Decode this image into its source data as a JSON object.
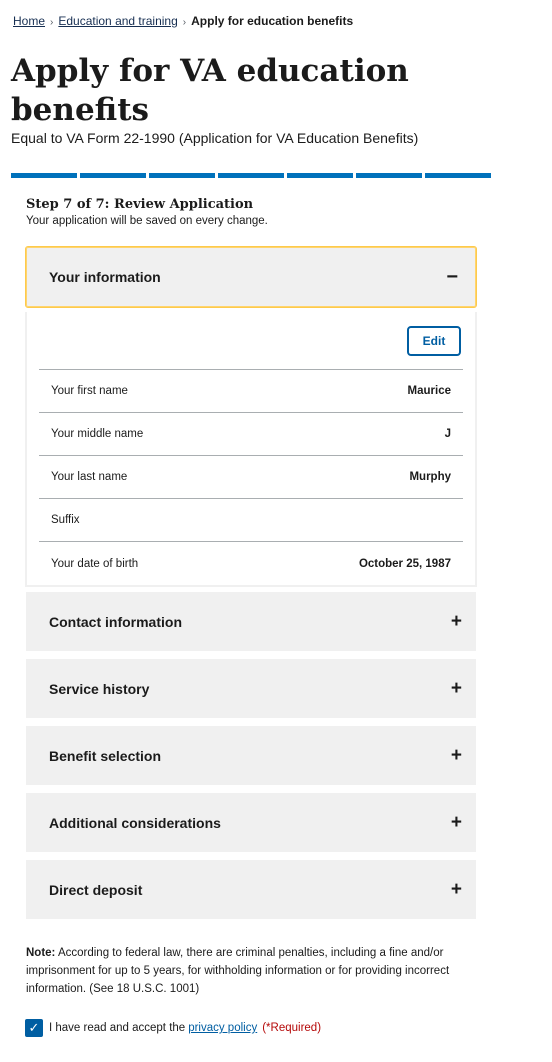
{
  "breadcrumb": {
    "items": [
      "Home",
      "Education and training"
    ],
    "current": "Apply for education benefits",
    "separator": "›"
  },
  "page": {
    "title": "Apply for VA education benefits",
    "subtitle": "Equal to VA Form 22-1990 (Application for VA Education Benefits)"
  },
  "progress": {
    "total_steps": 7,
    "completed_steps": 7,
    "color": "#0071bb"
  },
  "step": {
    "title": "Step 7 of 7: Review Application",
    "note": "Your application will be saved on every change."
  },
  "your_information": {
    "title": "Your information",
    "icon": "minus-icon",
    "edit_label": "Edit",
    "rows": [
      {
        "label": "Your first name",
        "value": "Maurice"
      },
      {
        "label": "Your middle name",
        "value": "J"
      },
      {
        "label": "Your last name",
        "value": "Murphy"
      },
      {
        "label": "Suffix",
        "value": ""
      },
      {
        "label": "Your date of birth",
        "value": "October 25, 1987"
      }
    ]
  },
  "sections": [
    {
      "title": "Contact information",
      "icon": "plus-icon"
    },
    {
      "title": "Service history",
      "icon": "plus-icon"
    },
    {
      "title": "Benefit selection",
      "icon": "plus-icon"
    },
    {
      "title": "Additional considerations",
      "icon": "plus-icon"
    },
    {
      "title": "Direct deposit",
      "icon": "plus-icon"
    }
  ],
  "note": {
    "label": "Note:",
    "text": " According to federal law, there are criminal penalties, including a fine and/or imprisonment for up to 5 years, for withholding information or for providing incorrect information. (See 18 U.S.C. 1001)"
  },
  "privacy": {
    "checked": true,
    "text": "I have read and accept the",
    "link": "privacy policy",
    "required": "(*Required)"
  },
  "colors": {
    "primary": "#005ea2",
    "focus": "#fdca4c",
    "required": "#b50909"
  }
}
